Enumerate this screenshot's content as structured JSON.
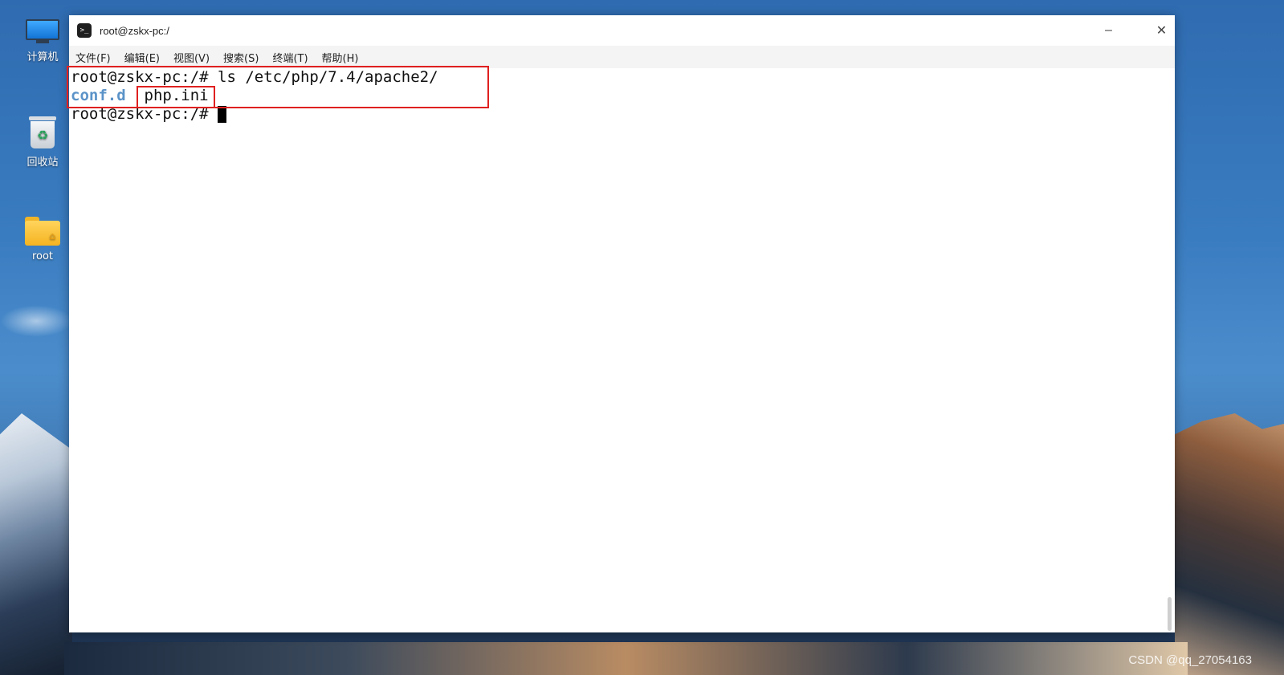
{
  "desktop": {
    "icons": [
      {
        "label": "计算机",
        "icon": "computer-icon"
      },
      {
        "label": "回收站",
        "icon": "recycle-bin-icon"
      },
      {
        "label": "root",
        "icon": "folder-home-icon"
      }
    ],
    "watermark": "CSDN @qq_27054163"
  },
  "window": {
    "title": "root@zskx-pc:/",
    "icon": "terminal-icon",
    "buttons": {
      "minimize": "minimize-icon",
      "maximize": "maximize-icon",
      "close": "close-icon"
    },
    "minimize_glyph": "–",
    "close_glyph": "✕"
  },
  "menu": [
    {
      "label": "文件(F)"
    },
    {
      "label": "编辑(E)"
    },
    {
      "label": "视图(V)"
    },
    {
      "label": "搜索(S)"
    },
    {
      "label": "终端(T)"
    },
    {
      "label": "帮助(H)"
    }
  ],
  "terminal": {
    "line1": "root@zskx-pc:/# ls /etc/php/7.4/apache2/",
    "dir_entry": "conf.d",
    "file_entry": "php.ini",
    "prompt": "root@zskx-pc:/# "
  },
  "colors": {
    "directory": "#5b93c8",
    "highlight_box": "#e02020"
  }
}
